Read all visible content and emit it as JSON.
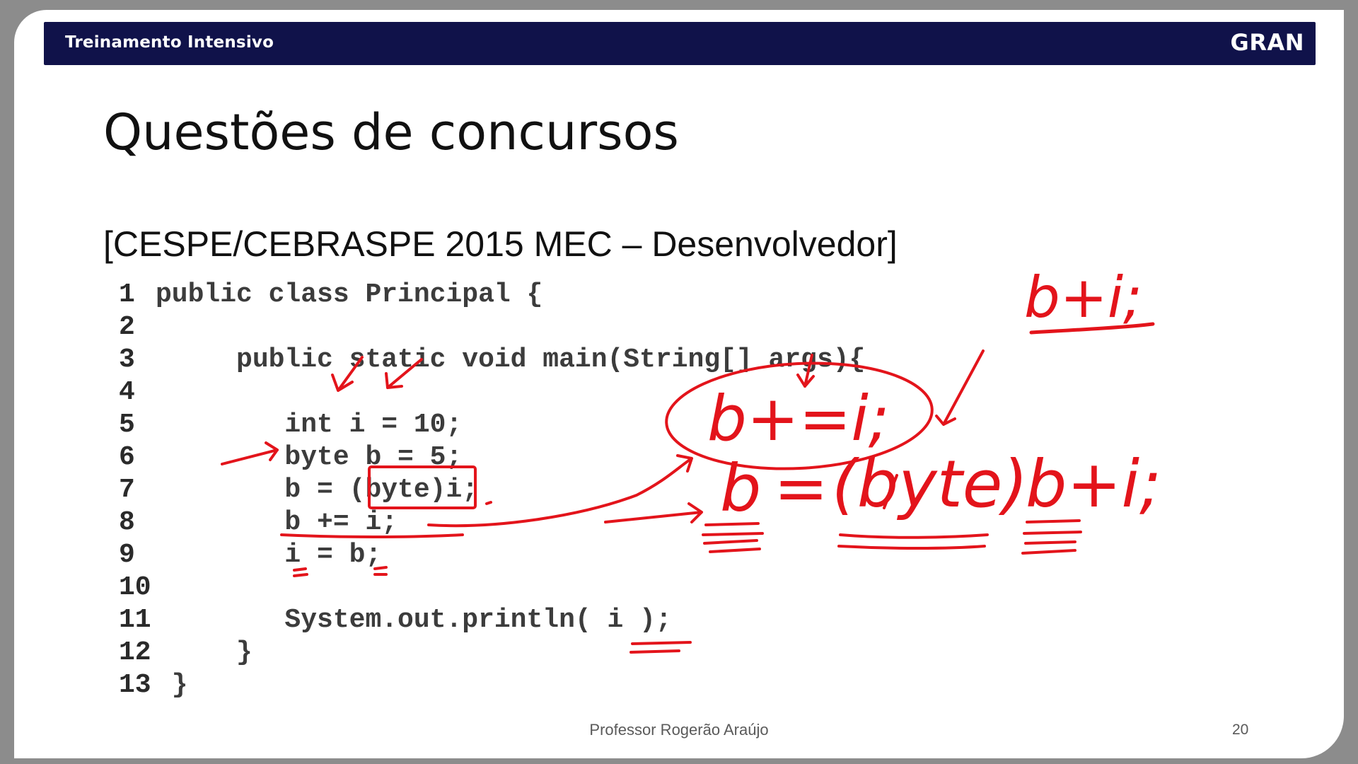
{
  "header": {
    "title": "Treinamento Intensivo",
    "brand": "GRAN"
  },
  "slide": {
    "title": "Questões de concursos",
    "question_source": "[CESPE/CEBRASPE 2015 MEC – Desenvolvedor]",
    "code_lines": [
      {
        "num": "1",
        "code": "public class Principal {"
      },
      {
        "num": "2",
        "code": ""
      },
      {
        "num": "3",
        "code": "     public static void main(String[] args){"
      },
      {
        "num": "4",
        "code": ""
      },
      {
        "num": "5",
        "code": "        int i = 10;"
      },
      {
        "num": "6",
        "code": "        byte b = 5;"
      },
      {
        "num": "7",
        "code": "        b = (byte)i;"
      },
      {
        "num": "8",
        "code": "        b += i;"
      },
      {
        "num": "9",
        "code": "        i = b;"
      },
      {
        "num": "10",
        "code": ""
      },
      {
        "num": "11",
        "code": "        System.out.println( i );"
      },
      {
        "num": "12",
        "code": "     }"
      },
      {
        "num": "13",
        "code": " }"
      }
    ]
  },
  "annotations": {
    "top_right_note": "b+i;",
    "circled_note": "b+=i;",
    "cast_note_lhs": "b",
    "cast_note_eq": "=",
    "cast_note_cast": "(byte)",
    "cast_note_rhs": "b+i;",
    "ink_color": "#e3141b"
  },
  "footer": {
    "author": "Professor Rogerão Araújo",
    "page_number": "20"
  }
}
